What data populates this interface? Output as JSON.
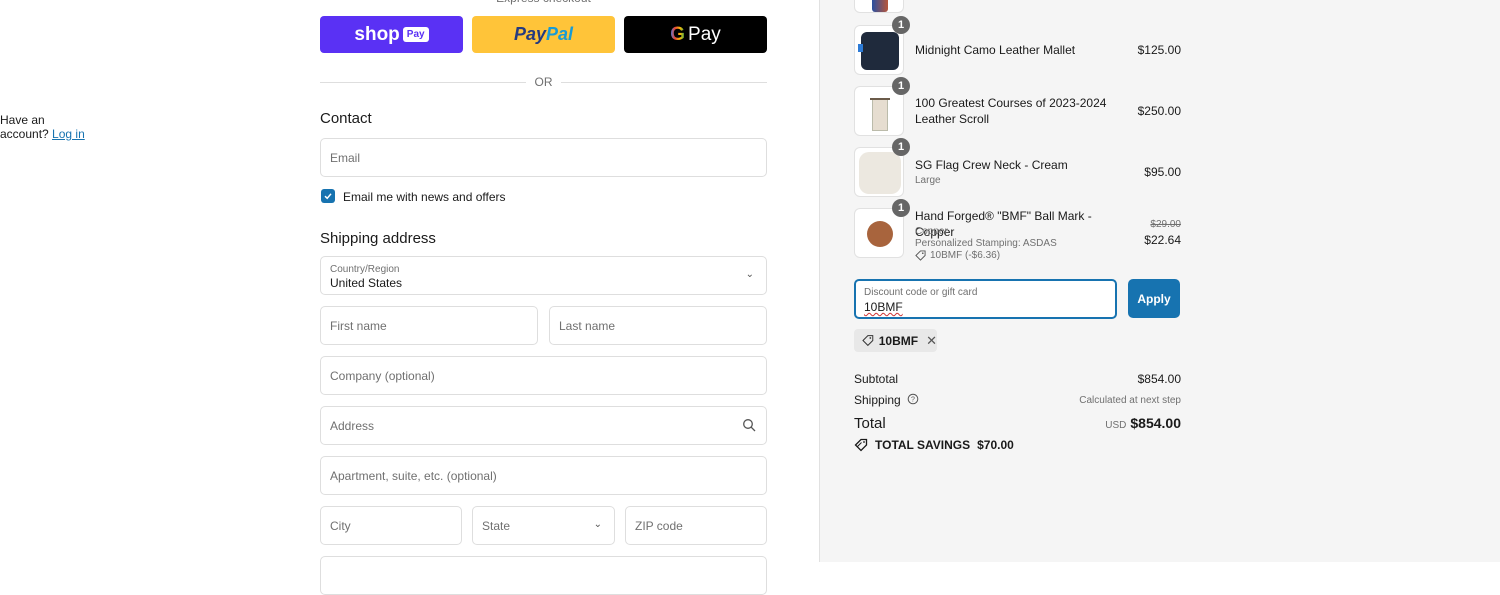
{
  "express": {
    "label": "Express checkout",
    "shop_pay": {
      "word": "shop",
      "chip": "Pay"
    },
    "paypal": {
      "part1": "Pay",
      "part2": "Pal"
    },
    "gpay": {
      "g": "G",
      "word": "Pay"
    }
  },
  "divider_text": "OR",
  "contact": {
    "heading": "Contact",
    "have_account": "Have an account?",
    "login_link": "Log in",
    "email_placeholder": "Email",
    "newsletter_label": "Email me with news and offers",
    "newsletter_checked": true
  },
  "shipping": {
    "heading": "Shipping address",
    "country_label": "Country/Region",
    "country_value": "United States",
    "first_name_placeholder": "First name",
    "last_name_placeholder": "Last name",
    "company_placeholder": "Company (optional)",
    "address_placeholder": "Address",
    "apartment_placeholder": "Apartment, suite, etc. (optional)",
    "city_placeholder": "City",
    "state_placeholder": "State",
    "zip_placeholder": "ZIP code"
  },
  "cart": {
    "items": [
      {
        "name": "Midnight Camo Leather Mallet",
        "qty": "1",
        "price": "$125.00"
      },
      {
        "name": "100 Greatest Courses of 2023-2024 Leather Scroll",
        "qty": "1",
        "price": "$250.00"
      },
      {
        "name": "SG Flag Crew Neck - Cream",
        "variant": "Large",
        "qty": "1",
        "price": "$95.00"
      },
      {
        "name": "Hand Forged® \"BMF\" Ball Mark - Copper",
        "variant": "Copper",
        "personalization": "Personalized Stamping: ASDAS",
        "discount": "10BMF (-$6.36)",
        "qty": "1",
        "original_price": "$29.00",
        "price": "$22.64"
      }
    ],
    "discount_label": "Discount code or gift card",
    "discount_value": "10BMF",
    "apply_label": "Apply",
    "applied_code": "10BMF"
  },
  "summary": {
    "subtotal_label": "Subtotal",
    "subtotal_value": "$854.00",
    "shipping_label": "Shipping",
    "shipping_value": "Calculated at next step",
    "total_label": "Total",
    "currency": "USD",
    "total_value": "$854.00",
    "savings_label": "TOTAL SAVINGS",
    "savings_value": "$70.00"
  }
}
